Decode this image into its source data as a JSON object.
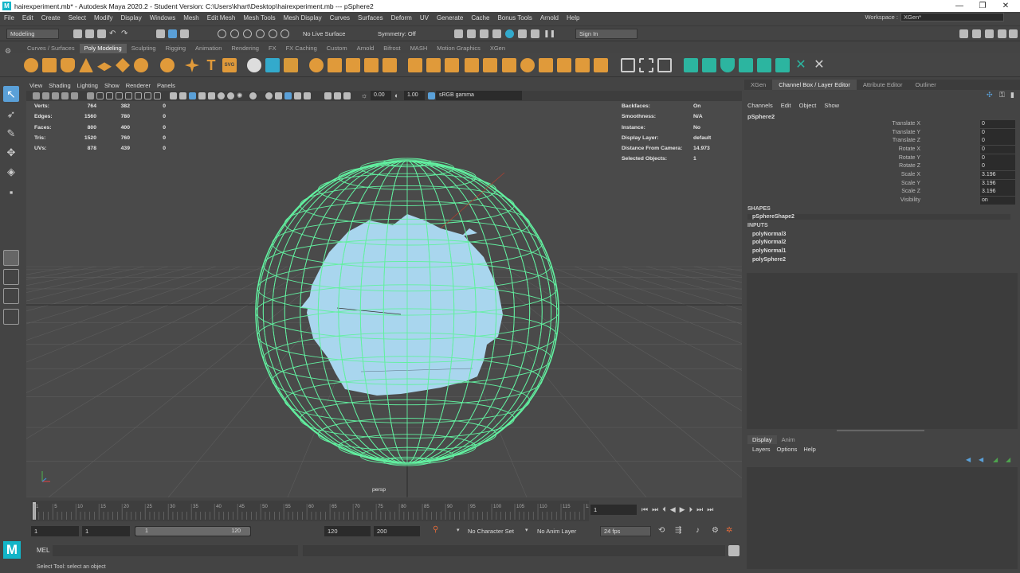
{
  "window": {
    "title": "hairexperiment.mb* - Autodesk Maya 2020.2 - Student Version: C:\\Users\\khart\\Desktop\\hairexperiment.mb   ---   pSphere2",
    "controls": [
      "—",
      "❐",
      "✕"
    ]
  },
  "menubar": [
    "File",
    "Edit",
    "Create",
    "Select",
    "Modify",
    "Display",
    "Windows",
    "Mesh",
    "Edit Mesh",
    "Mesh Tools",
    "Mesh Display",
    "Curves",
    "Surfaces",
    "Deform",
    "UV",
    "Generate",
    "Cache",
    "Bonus Tools",
    "Arnold",
    "Help"
  ],
  "workspace": {
    "label": "Workspace :",
    "value": "XGen*"
  },
  "statusline": {
    "mode": "Modeling",
    "live_surface": "No Live Surface",
    "symmetry": "Symmetry: Off",
    "signin": "Sign In"
  },
  "shelf_tabs": [
    "Curves / Surfaces",
    "Poly Modeling",
    "Sculpting",
    "Rigging",
    "Animation",
    "Rendering",
    "FX",
    "FX Caching",
    "Custom",
    "Arnold",
    "Bifrost",
    "MASH",
    "Motion Graphics",
    "XGen"
  ],
  "shelf_active": "Poly Modeling",
  "viewport": {
    "menu": [
      "View",
      "Shading",
      "Lighting",
      "Show",
      "Renderer",
      "Panels"
    ],
    "exposure": "0.00",
    "gamma": "1.00",
    "color_space": "sRGB gamma",
    "camera": "persp",
    "hud_left": [
      {
        "label": "Verts:",
        "a": "764",
        "b": "382",
        "c": "0"
      },
      {
        "label": "Edges:",
        "a": "1560",
        "b": "780",
        "c": "0"
      },
      {
        "label": "Faces:",
        "a": "800",
        "b": "400",
        "c": "0"
      },
      {
        "label": "Tris:",
        "a": "1520",
        "b": "760",
        "c": "0"
      },
      {
        "label": "UVs:",
        "a": "878",
        "b": "439",
        "c": "0"
      }
    ],
    "hud_right": [
      {
        "label": "Backfaces:",
        "value": "On"
      },
      {
        "label": "Smoothness:",
        "value": "N/A"
      },
      {
        "label": "Instance:",
        "value": "No"
      },
      {
        "label": "Display Layer:",
        "value": "default"
      },
      {
        "label": "Distance From Camera:",
        "value": "14.973"
      },
      {
        "label": "Selected Objects:",
        "value": "1"
      }
    ],
    "wire_color": "#62f0a0",
    "hair_color": "#a9d6ee"
  },
  "right_panel": {
    "tabs": [
      "XGen",
      "Channel Box / Layer Editor",
      "Attribute Editor",
      "Outliner"
    ],
    "active_tab": "Channel Box / Layer Editor",
    "channel_menu": [
      "Channels",
      "Edit",
      "Object",
      "Show"
    ],
    "object": "pSphere2",
    "channels": [
      {
        "label": "Translate X",
        "value": "0"
      },
      {
        "label": "Translate Y",
        "value": "0"
      },
      {
        "label": "Translate Z",
        "value": "0"
      },
      {
        "label": "Rotate X",
        "value": "0"
      },
      {
        "label": "Rotate Y",
        "value": "0"
      },
      {
        "label": "Rotate Z",
        "value": "0"
      },
      {
        "label": "Scale X",
        "value": "3.196"
      },
      {
        "label": "Scale Y",
        "value": "3.196"
      },
      {
        "label": "Scale Z",
        "value": "3.196"
      },
      {
        "label": "Visibility",
        "value": "on"
      }
    ],
    "shapes_header": "SHAPES",
    "shapes": [
      "pSphereShape2"
    ],
    "inputs_header": "INPUTS",
    "inputs": [
      "polyNormal3",
      "polyNormal2",
      "polyNormal1",
      "polySphere2"
    ],
    "layer_tabs": [
      "Display",
      "Anim"
    ],
    "layer_menu": [
      "Layers",
      "Options",
      "Help"
    ]
  },
  "timeline": {
    "ticks": [
      "1",
      "5",
      "10",
      "15",
      "20",
      "25",
      "30",
      "35",
      "40",
      "45",
      "50",
      "55",
      "60",
      "65",
      "70",
      "75",
      "80",
      "85",
      "90",
      "95",
      "100",
      "105",
      "110",
      "115",
      "120"
    ],
    "current_frame": "1",
    "range_start": "1",
    "playback_start": "1",
    "slider_start": "1",
    "slider_end": "120",
    "playback_end": "120",
    "range_end": "200",
    "character_set": "No Character Set",
    "anim_layer": "No Anim Layer",
    "fps": "24 fps"
  },
  "command": {
    "label": "MEL"
  },
  "help_line": "Select Tool: select an object"
}
